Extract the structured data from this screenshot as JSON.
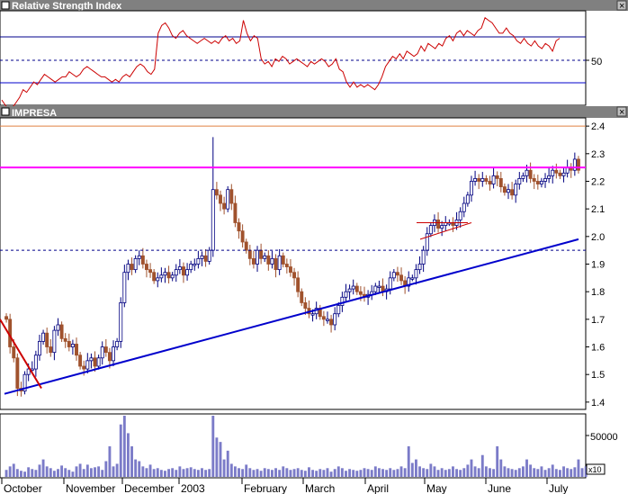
{
  "colors": {
    "background": "#ffffff",
    "title_bar": "#808080",
    "title_text": "#ffffff",
    "frame": "#000000",
    "rsi_line": "#cc0000",
    "rsi_level": "#00008b",
    "resistance_magenta": "#ff00ff",
    "top_orange": "#e08040",
    "trend_blue": "#0000cc",
    "dashed_blue": "#00008b",
    "candle_up": "#ffffff",
    "candle_up_border": "#000080",
    "candle_down": "#a0522d",
    "down_trend_red": "#cc0000",
    "volume_bars": "#7b7bc8"
  },
  "panels": {
    "rsi": {
      "title": "Relative Strength Index",
      "tick_label": "50"
    },
    "price": {
      "title": "IMPRESA"
    },
    "volume": {
      "tick_label": "50000",
      "multiplier": "x10"
    }
  },
  "window_buttons": {
    "close": "×"
  },
  "chart_data": [
    {
      "type": "line",
      "series": [
        {
          "values": [
            69,
            67,
            65,
            66,
            68,
            70,
            73,
            72,
            74,
            76,
            75,
            77,
            79,
            78,
            77,
            76,
            77,
            78,
            78,
            80,
            79,
            78,
            79,
            81,
            82,
            81,
            80,
            79,
            78,
            78,
            77,
            76,
            77,
            76,
            78,
            79,
            78,
            80,
            82,
            83,
            82,
            80,
            79,
            81,
            95,
            98,
            99,
            97,
            94,
            93,
            95,
            96,
            94,
            93,
            92,
            91,
            92,
            93,
            92,
            91,
            92,
            91,
            93,
            94,
            92,
            93,
            91,
            92,
            100,
            95,
            92,
            94,
            93,
            85,
            83,
            84,
            82,
            85,
            84,
            86,
            85,
            83,
            84,
            85,
            84,
            83,
            82,
            84,
            83,
            84,
            85,
            84,
            82,
            83,
            85,
            81,
            80,
            76,
            74,
            76,
            74,
            75,
            74,
            75,
            74,
            73,
            75,
            78,
            82,
            84,
            86,
            85,
            87,
            85,
            88,
            87,
            86,
            87,
            90,
            88,
            91,
            90,
            89,
            91,
            90,
            93,
            94,
            92,
            95,
            96,
            94,
            96,
            95,
            94,
            96,
            97,
            101,
            100,
            99,
            97,
            95,
            95,
            97,
            95,
            94,
            92,
            91,
            93,
            91,
            90,
            92,
            90,
            89,
            91,
            90,
            88,
            92,
            93
          ],
          "ylim": [
            68,
            103
          ],
          "reference_lines": [
            93,
            84,
            76
          ]
        }
      ],
      "ytick_labels": [
        "50"
      ]
    },
    {
      "type": "candlestick",
      "yticks": [
        "2.4",
        "2.3",
        "2.2",
        "2.1",
        "2.0",
        "1.9",
        "1.8",
        "1.7",
        "1.6",
        "1.5",
        "1.4"
      ],
      "ylim": [
        1.38,
        2.42
      ],
      "xtick_labels": [
        "October",
        "November",
        "December",
        "2003",
        "February",
        "March",
        "April",
        "May",
        "June",
        "July"
      ],
      "resistance_level": 2.25,
      "top_level": 2.4,
      "dashed_level": 1.95,
      "trend_line": {
        "start": 1.43,
        "end": 1.99
      },
      "down_trend": {
        "start": 1.7,
        "end": 1.45
      },
      "flag_lines": [
        {
          "start": 2.05,
          "end": 2.05
        },
        {
          "start": 1.99,
          "end": 2.05
        }
      ],
      "closes": [
        1.7,
        1.6,
        1.56,
        1.45,
        1.44,
        1.5,
        1.52,
        1.52,
        1.57,
        1.62,
        1.65,
        1.6,
        1.58,
        1.66,
        1.68,
        1.63,
        1.62,
        1.6,
        1.61,
        1.57,
        1.53,
        1.52,
        1.55,
        1.56,
        1.53,
        1.56,
        1.6,
        1.58,
        1.55,
        1.6,
        1.62,
        1.76,
        1.87,
        1.9,
        1.88,
        1.92,
        1.93,
        1.9,
        1.88,
        1.87,
        1.84,
        1.85,
        1.86,
        1.87,
        1.85,
        1.86,
        1.88,
        1.89,
        1.86,
        1.88,
        1.9,
        1.9,
        1.92,
        1.93,
        1.91,
        1.95,
        2.17,
        2.15,
        2.12,
        2.1,
        2.17,
        2.12,
        2.05,
        2.02,
        1.98,
        1.95,
        1.92,
        1.9,
        1.95,
        1.92,
        1.93,
        1.9,
        1.92,
        1.88,
        1.93,
        1.9,
        1.89,
        1.87,
        1.85,
        1.8,
        1.76,
        1.74,
        1.72,
        1.72,
        1.74,
        1.71,
        1.7,
        1.7,
        1.68,
        1.72,
        1.75,
        1.78,
        1.8,
        1.81,
        1.82,
        1.8,
        1.79,
        1.78,
        1.79,
        1.8,
        1.82,
        1.82,
        1.8,
        1.81,
        1.85,
        1.87,
        1.86,
        1.84,
        1.82,
        1.85,
        1.85,
        1.88,
        1.9,
        1.95,
        2.01,
        2.04,
        2.06,
        2.03,
        2.04,
        2.05,
        2.05,
        2.04,
        2.06,
        2.09,
        2.12,
        2.15,
        2.2,
        2.21,
        2.2,
        2.21,
        2.2,
        2.19,
        2.22,
        2.21,
        2.18,
        2.16,
        2.17,
        2.15,
        2.19,
        2.21,
        2.22,
        2.24,
        2.21,
        2.2,
        2.19,
        2.2,
        2.21,
        2.22,
        2.24,
        2.23,
        2.22,
        2.23,
        2.25,
        2.24,
        2.28,
        2.24
      ]
    },
    {
      "type": "bar",
      "ylim": [
        0,
        70000
      ],
      "ytick_labels": [
        "50000"
      ],
      "values": [
        8000,
        12000,
        15000,
        9000,
        7000,
        6000,
        11000,
        9000,
        8000,
        14000,
        20000,
        12000,
        10000,
        7000,
        9000,
        13000,
        10000,
        8000,
        6000,
        12000,
        15000,
        9000,
        14000,
        10000,
        11000,
        12000,
        8000,
        18000,
        35000,
        12000,
        15000,
        60000,
        70000,
        50000,
        35000,
        20000,
        18000,
        12000,
        10000,
        14000,
        9000,
        10000,
        8000,
        7000,
        9000,
        10000,
        8000,
        12000,
        9000,
        10000,
        11000,
        9000,
        8000,
        10000,
        8000,
        9000,
        70000,
        45000,
        40000,
        20000,
        30000,
        15000,
        12000,
        10000,
        9000,
        14000,
        10000,
        8000,
        9000,
        7000,
        10000,
        9000,
        8000,
        10000,
        8000,
        12000,
        10000,
        8000,
        9000,
        10000,
        8000,
        7000,
        11000,
        8000,
        7000,
        9000,
        8000,
        10000,
        6000,
        9000,
        12000,
        10000,
        7000,
        9000,
        8000,
        7000,
        8000,
        10000,
        9000,
        8000,
        12000,
        10000,
        9000,
        8000,
        10000,
        8000,
        9000,
        12000,
        10000,
        35000,
        16000,
        20000,
        12000,
        10000,
        9000,
        15000,
        12000,
        8000,
        10000,
        8000,
        9000,
        12000,
        9000,
        8000,
        10000,
        14000,
        20000,
        12000,
        10000,
        25000,
        12000,
        10000,
        9000,
        35000,
        20000,
        12000,
        10000,
        9000,
        8000,
        10000,
        12000,
        20000,
        14000,
        10000,
        9000,
        12000,
        8000,
        10000,
        14000,
        9000,
        8000,
        12000,
        10000,
        9000,
        11000,
        20000,
        10000,
        12000
      ]
    }
  ]
}
